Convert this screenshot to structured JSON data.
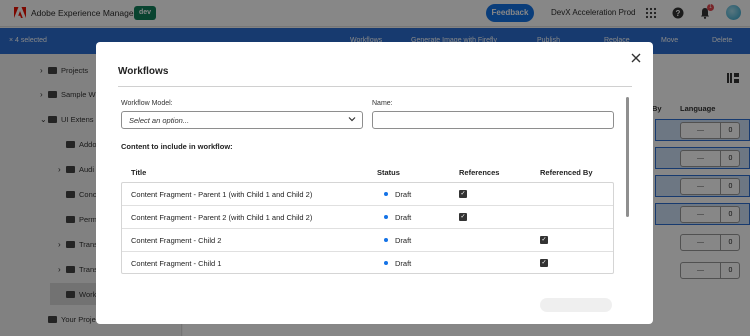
{
  "header": {
    "product": "Adobe Experience Manager",
    "env_badge": "dev",
    "feedback": "Feedback",
    "org": "DevX Acceleration Prod",
    "notification_count": "1"
  },
  "actionbar": {
    "selected": "× 4 selected",
    "actions": [
      "Workflows",
      "Generate Image with Firefly",
      "Publish",
      "Replace",
      "Move",
      "Delete"
    ]
  },
  "tree": {
    "items": [
      {
        "label": "Projects",
        "chev": "›"
      },
      {
        "label": "Sample W",
        "chev": "›"
      },
      {
        "label": "UI Extens",
        "chev": "⌄"
      },
      {
        "label": "Addo",
        "chev": ""
      },
      {
        "label": "Audi",
        "chev": "›"
      },
      {
        "label": "Conc",
        "chev": ""
      },
      {
        "label": "Perm",
        "chev": ""
      },
      {
        "label": "Trans",
        "chev": "›"
      },
      {
        "label": "Trans",
        "chev": "›"
      },
      {
        "label": "Worki",
        "chev": ""
      },
      {
        "label": "Your Proje",
        "chev": ""
      }
    ]
  },
  "rightpane": {
    "col_by": "By",
    "col_language": "Language",
    "stepper_values": [
      "0",
      "0",
      "0",
      "0",
      "0",
      "0"
    ],
    "stepper_minus": "—"
  },
  "dialog": {
    "title": "Workflows",
    "workflow_model_label": "Workflow Model:",
    "workflow_model_placeholder": "Select an option...",
    "name_label": "Name:",
    "name_value": "",
    "content_label": "Content to include in workflow:",
    "columns": {
      "title": "Title",
      "status": "Status",
      "references": "References",
      "referenced_by": "Referenced By"
    },
    "rows": [
      {
        "title": "Content Fragment - Parent 1 (with Child 1 and Child 2)",
        "status": "Draft",
        "references": true,
        "referenced_by": false
      },
      {
        "title": "Content Fragment - Parent 2 (with Child 1 and Child 2)",
        "status": "Draft",
        "references": true,
        "referenced_by": false
      },
      {
        "title": "Content Fragment - Child 2",
        "status": "Draft",
        "references": false,
        "referenced_by": true
      },
      {
        "title": "Content Fragment - Child 1",
        "status": "Draft",
        "references": false,
        "referenced_by": true
      }
    ]
  },
  "colors": {
    "brand_red": "#eb1000",
    "accent_blue": "#1473e6",
    "actionbar_blue": "#2d6fd1",
    "env_green": "#12805c",
    "status_draft": "#1473e6"
  }
}
